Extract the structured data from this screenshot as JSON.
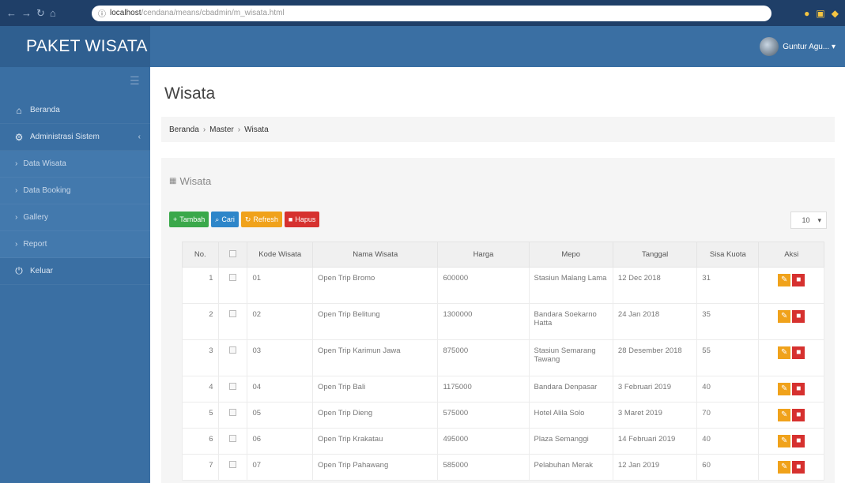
{
  "browser": {
    "url_host": "localhost",
    "url_path": "/cendana/means/cbadmin/m_wisata.html"
  },
  "topbar": {
    "brand": "PAKET WISATA",
    "user_name": "Guntur Agu... ▾"
  },
  "sidebar": {
    "items": [
      {
        "label": "Beranda",
        "icon": "home-icon"
      },
      {
        "label": "Administrasi Sistem",
        "icon": "cogs-icon"
      },
      {
        "label": "Data Wisata",
        "icon": "chevron-right-icon"
      },
      {
        "label": "Data Booking",
        "icon": "chevron-right-icon"
      },
      {
        "label": "Gallery",
        "icon": "chevron-right-icon"
      },
      {
        "label": "Report",
        "icon": "chevron-right-icon"
      },
      {
        "label": "Keluar",
        "icon": "logout-icon"
      }
    ]
  },
  "main": {
    "title": "Wisata",
    "breadcrumb": [
      "Beranda",
      "Master",
      "Wisata"
    ],
    "panel_title": "Wisata",
    "buttons": {
      "add": "Tambah",
      "search": "Cari",
      "refresh": "Refresh",
      "delete": "Hapus"
    },
    "page_size": "10"
  },
  "table": {
    "headers": [
      "No.",
      "",
      "Kode Wisata",
      "Nama Wisata",
      "Harga",
      "Mepo",
      "Tanggal",
      "Sisa Kuota",
      "Aksi"
    ],
    "rows": [
      {
        "no": "1",
        "kode": "01",
        "nama": "Open Trip Bromo",
        "harga": "600000",
        "mepo": "Stasiun Malang Lama",
        "tanggal": "12 Dec 2018",
        "kuota": "31"
      },
      {
        "no": "2",
        "kode": "02",
        "nama": "Open Trip Belitung",
        "harga": "1300000",
        "mepo": "Bandara Soekarno Hatta",
        "tanggal": "24 Jan 2018",
        "kuota": "35"
      },
      {
        "no": "3",
        "kode": "03",
        "nama": "Open Trip Karimun Jawa",
        "harga": "875000",
        "mepo": "Stasiun Semarang Tawang",
        "tanggal": "28 Desember 2018",
        "kuota": "55"
      },
      {
        "no": "4",
        "kode": "04",
        "nama": "Open Trip Bali",
        "harga": "1175000",
        "mepo": "Bandara Denpasar",
        "tanggal": "3 Februari 2019",
        "kuota": "40"
      },
      {
        "no": "5",
        "kode": "05",
        "nama": "Open Trip Dieng",
        "harga": "575000",
        "mepo": "Hotel Alila Solo",
        "tanggal": "3 Maret 2019",
        "kuota": "70"
      },
      {
        "no": "6",
        "kode": "06",
        "nama": "Open Trip Krakatau",
        "harga": "495000",
        "mepo": "Plaza Semanggi",
        "tanggal": "14 Februari 2019",
        "kuota": "40"
      },
      {
        "no": "7",
        "kode": "07",
        "nama": "Open Trip Pahawang",
        "harga": "585000",
        "mepo": "Pelabuhan Merak",
        "tanggal": "12 Jan 2019",
        "kuota": "60"
      }
    ]
  },
  "colors": {
    "sidebar": "#3a6fa3",
    "brand_bg": "#2f5f90",
    "btn_add": "#3aa84a",
    "btn_search": "#2e86c9",
    "btn_refresh": "#f0a21b",
    "btn_delete": "#d6312f"
  }
}
